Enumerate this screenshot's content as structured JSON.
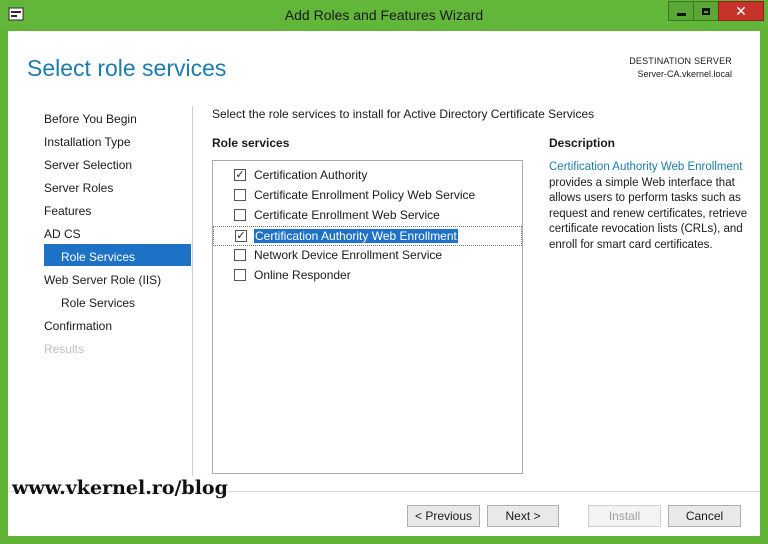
{
  "window": {
    "title": "Add Roles and Features Wizard",
    "icon": "server-manager-icon",
    "accent": "#5fb234",
    "close_glyph": "✕"
  },
  "header": {
    "page_title": "Select role services",
    "destination_label": "DESTINATION SERVER",
    "destination_server": "Server-CA.vkernel.local"
  },
  "nav": {
    "items": [
      {
        "label": "Before You Begin",
        "state": "normal"
      },
      {
        "label": "Installation Type",
        "state": "normal"
      },
      {
        "label": "Server Selection",
        "state": "normal"
      },
      {
        "label": "Server Roles",
        "state": "normal"
      },
      {
        "label": "Features",
        "state": "normal"
      },
      {
        "label": "AD CS",
        "state": "normal"
      },
      {
        "label": "Role Services",
        "state": "selected"
      },
      {
        "label": "Web Server Role (IIS)",
        "state": "normal"
      },
      {
        "label": "Role Services",
        "state": "normal"
      },
      {
        "label": "Confirmation",
        "state": "normal"
      },
      {
        "label": "Results",
        "state": "disabled"
      }
    ]
  },
  "main": {
    "instruction": "Select the role services to install for Active Directory Certificate Services",
    "role_services_header": "Role services",
    "role_services": [
      {
        "label": "Certification Authority",
        "checked": true
      },
      {
        "label": "Certificate Enrollment Policy Web Service",
        "checked": false
      },
      {
        "label": "Certificate Enrollment Web Service",
        "checked": false
      },
      {
        "label": "Certification Authority Web Enrollment",
        "checked": true,
        "selected": true
      },
      {
        "label": "Network Device Enrollment Service",
        "checked": false
      },
      {
        "label": "Online Responder",
        "checked": false
      }
    ],
    "description_header": "Description",
    "description_link": "Certification Authority Web Enrollment",
    "description_text": " provides a simple Web interface that allows users to perform tasks such as request and renew certificates, retrieve certificate revocation lists (CRLs), and enroll for smart card certificates."
  },
  "footer": {
    "previous_label": "< Previous",
    "next_label": "Next >",
    "install_label": "Install",
    "cancel_label": "Cancel"
  },
  "watermark": "www.vkernel.ro/blog",
  "check_glyph": "✓"
}
